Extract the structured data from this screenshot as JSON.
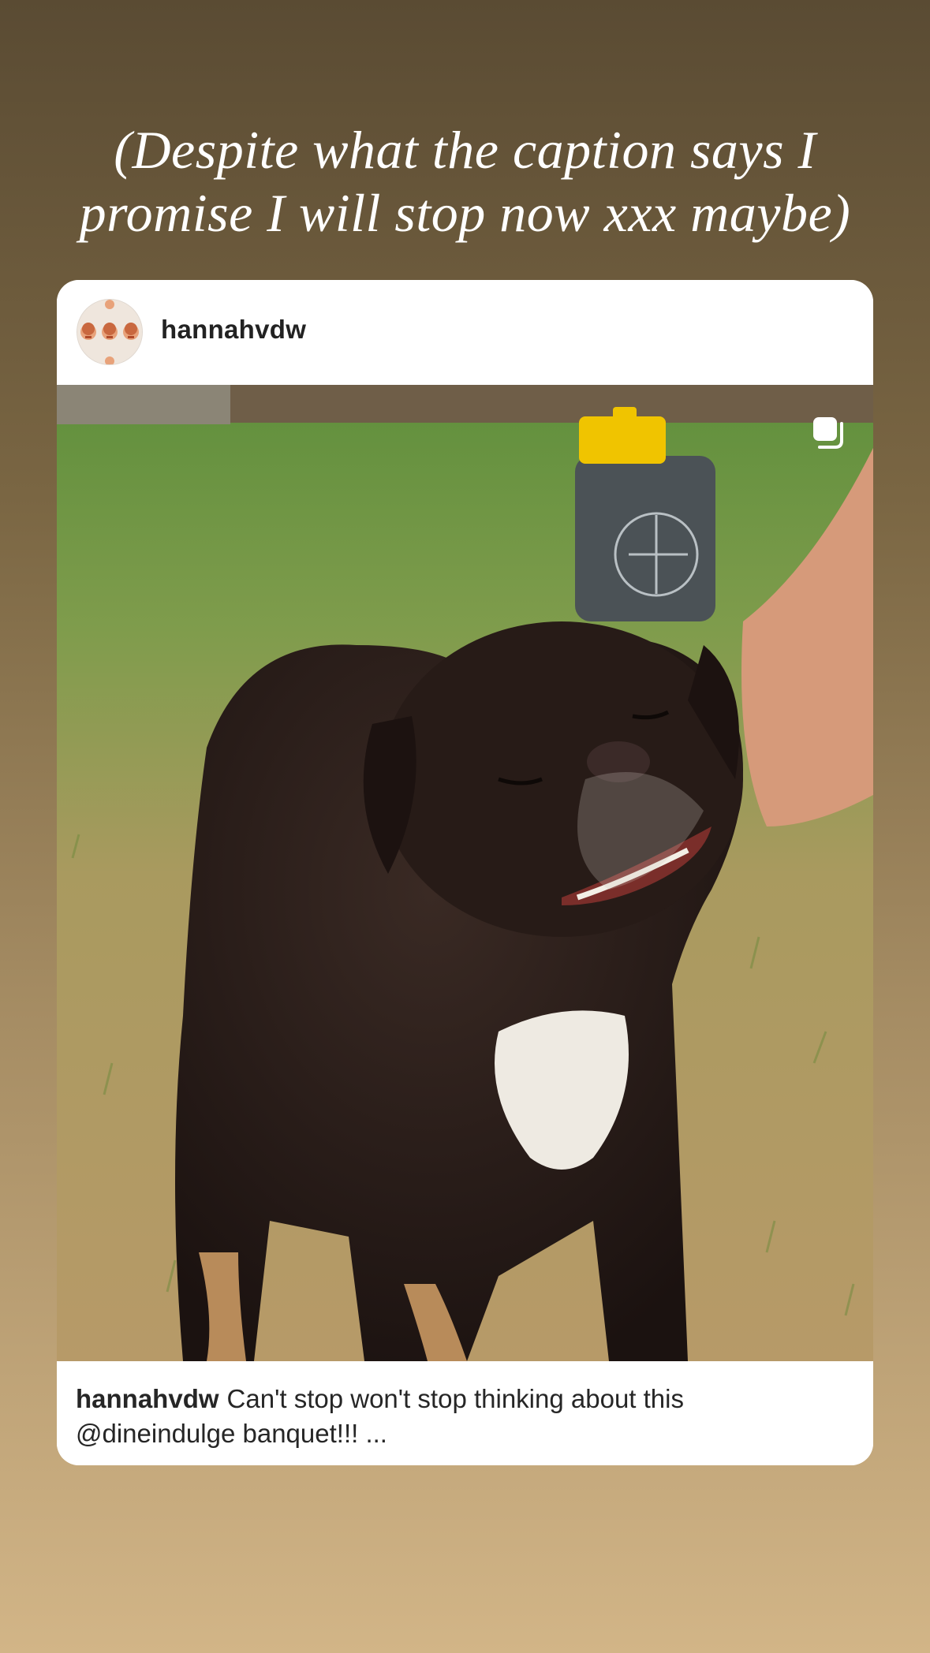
{
  "story": {
    "caption": "(Despite what the caption says I promise I will stop now xxx maybe)"
  },
  "post": {
    "username": "hannahvdw",
    "caption_user": "hannahvdw",
    "caption_line1": "Can't stop won't stop thinking about this",
    "caption_line2": "@dineindulge banquet!!! ...",
    "icons": {
      "carousel": "carousel-multiple-icon"
    }
  },
  "colors": {
    "card_background": "#ffffff",
    "gradient_top": "#5a4b33",
    "gradient_bottom": "#d2b587"
  }
}
